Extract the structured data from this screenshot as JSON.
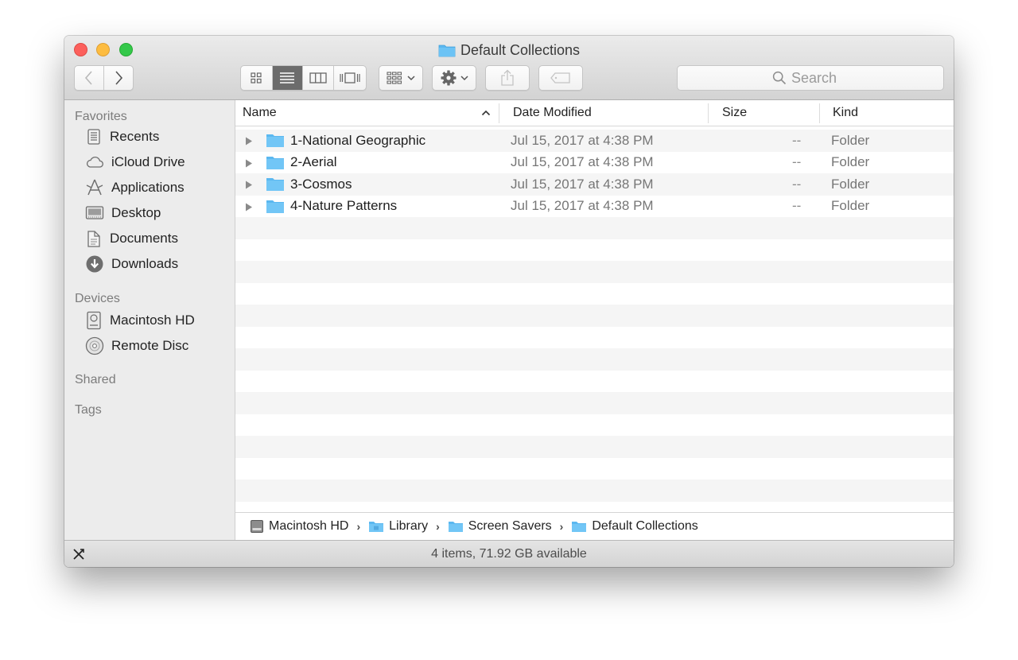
{
  "window": {
    "title": "Default Collections"
  },
  "toolbar": {
    "back_icon": "chevron-left-icon",
    "forward_icon": "chevron-right-icon",
    "view_modes": [
      "icon-view",
      "list-view",
      "column-view",
      "cover-flow-view"
    ],
    "active_view": "list-view",
    "search_placeholder": "Search"
  },
  "sidebar": {
    "favorites_heading": "Favorites",
    "favorites": [
      {
        "label": "Recents",
        "icon": "recents-icon"
      },
      {
        "label": "iCloud Drive",
        "icon": "cloud-icon"
      },
      {
        "label": "Applications",
        "icon": "applications-icon"
      },
      {
        "label": "Desktop",
        "icon": "desktop-icon"
      },
      {
        "label": "Documents",
        "icon": "documents-icon"
      },
      {
        "label": "Downloads",
        "icon": "downloads-icon"
      }
    ],
    "devices_heading": "Devices",
    "devices": [
      {
        "label": "Macintosh HD",
        "icon": "hard-drive-icon"
      },
      {
        "label": "Remote Disc",
        "icon": "disc-icon"
      }
    ],
    "shared_heading": "Shared",
    "tags_heading": "Tags"
  },
  "columns": {
    "name": "Name",
    "date": "Date Modified",
    "size": "Size",
    "kind": "Kind"
  },
  "files": [
    {
      "name": "1-National Geographic",
      "date": "Jul 15, 2017 at 4:38 PM",
      "size": "--",
      "kind": "Folder"
    },
    {
      "name": "2-Aerial",
      "date": "Jul 15, 2017 at 4:38 PM",
      "size": "--",
      "kind": "Folder"
    },
    {
      "name": "3-Cosmos",
      "date": "Jul 15, 2017 at 4:38 PM",
      "size": "--",
      "kind": "Folder"
    },
    {
      "name": "4-Nature Patterns",
      "date": "Jul 15, 2017 at 4:38 PM",
      "size": "--",
      "kind": "Folder"
    }
  ],
  "pathbar": [
    "Macintosh HD",
    "Library",
    "Screen Savers",
    "Default Collections"
  ],
  "status": "4 items, 71.92 GB available",
  "colors": {
    "folder_blue": "#5bb8f0",
    "close": "#fc605c",
    "minimize": "#fdbc40",
    "zoom": "#34c84a"
  }
}
